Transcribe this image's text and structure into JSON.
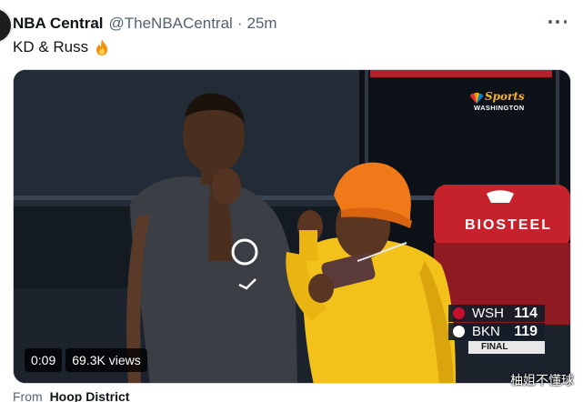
{
  "tweet": {
    "author_name": "NBA Central",
    "author_handle": "@TheNBACentral",
    "separator": "·",
    "time": "25m",
    "text": "KD & Russ",
    "text_emoji_icon": "fire-icon"
  },
  "media": {
    "channel_bug": {
      "brand": "Sports",
      "city": "WASHINGTON"
    },
    "seat_branding": "BIOSTEEL",
    "scoreboard": {
      "rows": [
        {
          "team": "WSH",
          "score": "114",
          "color": "#c8102e"
        },
        {
          "team": "BKN",
          "score": "119",
          "color": "#ffffff"
        }
      ],
      "status": "FINAL"
    },
    "player": {
      "duration": "0:09",
      "views": "69.3K views"
    },
    "watermark": "柚姐不懂球"
  },
  "source": {
    "prefix": "From",
    "name": "Hoop District"
  },
  "colors": {
    "text": "#0f1419",
    "secondary": "#536471",
    "hat": "#f07a1a",
    "jacket": "#f2c21b"
  }
}
